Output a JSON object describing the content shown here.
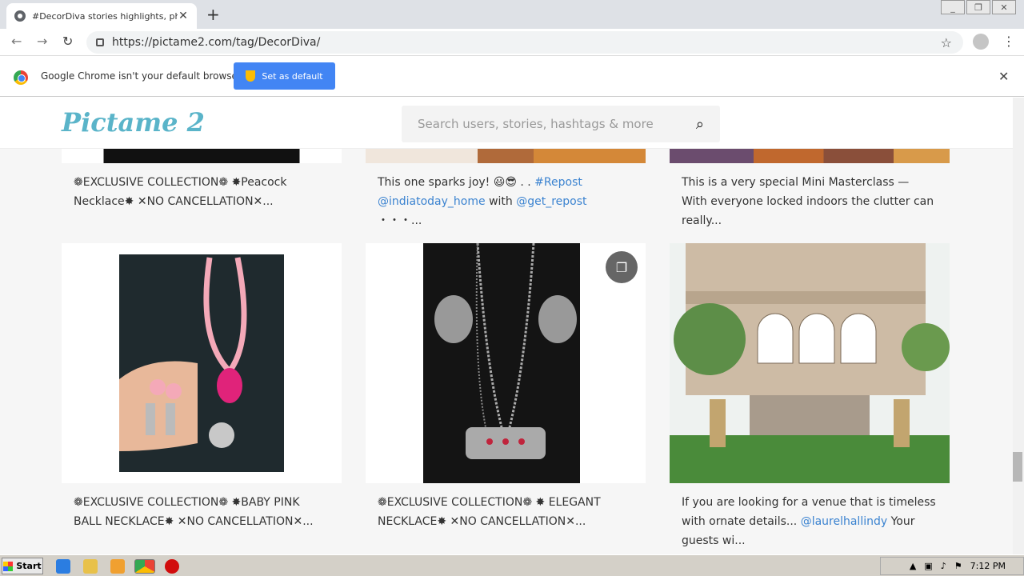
{
  "browser": {
    "tab_title": "#DecorDiva stories highlights, photo",
    "url": "https://pictame2.com/tag/DecorDiva/",
    "infobar_text": "Google Chrome isn't your default browser",
    "infobar_button": "Set as default"
  },
  "site": {
    "logo": "Pictame 2",
    "search_placeholder": "Search users, stories, hashtags & more"
  },
  "posts": [
    {
      "caption_pre": "",
      "caption": "❁EXCLUSIVE COLLECTION❁ ✸Peacock Necklace✸ ✕NO CANCELLATION✕..."
    },
    {
      "caption_pre": "This one sparks joy! 😃😎 . . ",
      "link1": "#Repost",
      "link2": "@indiatoday_home",
      "mid": " with ",
      "link3": "@get_repost",
      "tail": " ・・・..."
    },
    {
      "caption": "This is a very special Mini Masterclass — With everyone locked indoors the clutter can really..."
    },
    {
      "caption": "❁EXCLUSIVE COLLECTION❁ ✸BABY PINK BALL NECKLACE✸ ✕NO CANCELLATION✕..."
    },
    {
      "caption": "❁EXCLUSIVE COLLECTION❁ ✸ ELEGANT NECKLACE✸ ✕NO CANCELLATION✕..."
    },
    {
      "caption_pre": "If you are looking for a venue that is timeless with ornate details... ",
      "link1": "@laurelhallindy",
      "tail": " Your guests wi..."
    }
  ],
  "taskbar": {
    "start": "Start",
    "clock": "7:12 PM"
  },
  "colors": {
    "link": "#3b83d0",
    "logo": "#5ab4c9",
    "accent_button": "#4285f4"
  }
}
